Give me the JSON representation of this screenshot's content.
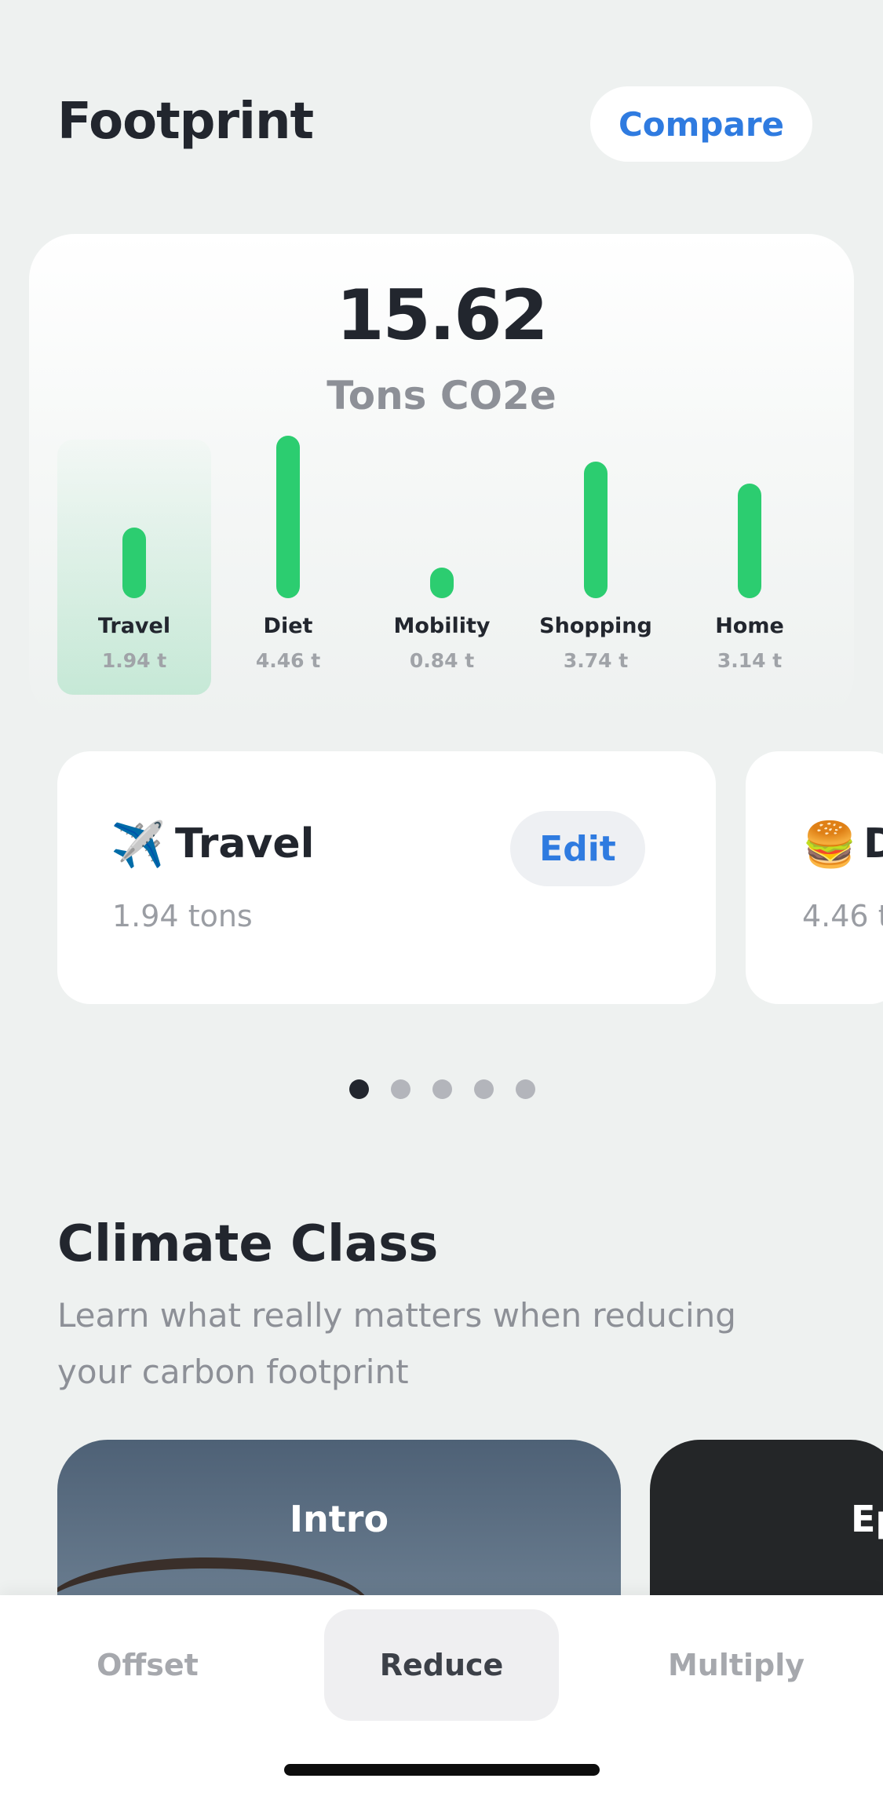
{
  "header": {
    "title": "Footprint",
    "compare_label": "Compare"
  },
  "summary": {
    "total": "15.62",
    "unit": "Tons CO2e"
  },
  "categories": [
    {
      "label": "Travel",
      "value_text": "1.94 t",
      "value": 1.94
    },
    {
      "label": "Diet",
      "value_text": "4.46 t",
      "value": 4.46
    },
    {
      "label": "Mobility",
      "value_text": "0.84 t",
      "value": 0.84
    },
    {
      "label": "Shopping",
      "value_text": "3.74 t",
      "value": 3.74
    },
    {
      "label": "Home",
      "value_text": "3.14 t",
      "value": 3.14
    }
  ],
  "carousel": {
    "cards": [
      {
        "emoji": "✈️",
        "title": "Travel",
        "subtitle": "1.94 tons",
        "edit_label": "Edit"
      },
      {
        "emoji": "🍔",
        "title": "D",
        "subtitle": "4.46 t"
      }
    ],
    "page_count": 5,
    "active_page": 1
  },
  "climate_class": {
    "title": "Climate Class",
    "description": "Learn what really matters when reducing your carbon footprint",
    "cards": [
      {
        "label": "Intro"
      },
      {
        "label": "Ep"
      }
    ]
  },
  "tabs": [
    {
      "label": "Offset",
      "active": false
    },
    {
      "label": "Reduce",
      "active": true
    },
    {
      "label": "Multiply",
      "active": false
    }
  ],
  "colors": {
    "accent": "#2f7be0",
    "bar": "#2ccd70",
    "text": "#22262e",
    "muted": "#8d9097"
  }
}
